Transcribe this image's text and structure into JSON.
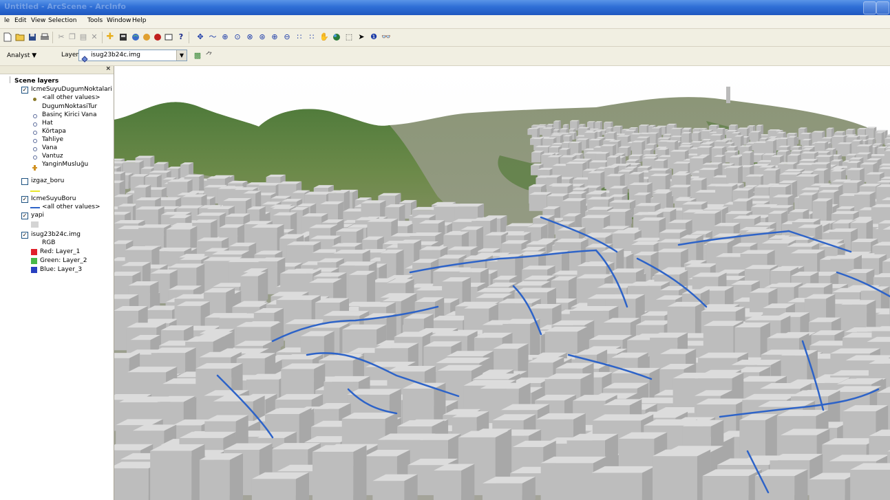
{
  "window": {
    "title": "Untitled - ArcScene - ArcInfo"
  },
  "menu": {
    "file": "le",
    "edit": "Edit",
    "view": "View",
    "selection": "Selection",
    "tools": "Tools",
    "window": "Window",
    "help": "Help"
  },
  "toolbar2": {
    "analyst_label": "Analyst ▼",
    "layer_label": "Layer:",
    "layer_value": "isug23b24c.img"
  },
  "toc": {
    "root": "Scene layers",
    "layers": [
      {
        "name": "IcmeSuyuDugumNoktalari",
        "checked": true
      },
      {
        "name": "izgaz_boru",
        "checked": false
      },
      {
        "name": "IcmeSuyuBoru",
        "checked": true
      },
      {
        "name": "yapi",
        "checked": true
      },
      {
        "name": "isug23b24c.img",
        "checked": true
      }
    ],
    "node_all_other": "<all other values>",
    "node_field": "DugumNoktasiTur",
    "node_values": [
      "Basinç Kirici Vana",
      "Hat",
      "Körtapa",
      "Tahliye",
      "Vana",
      "Vantuz",
      "YanginMusluğu"
    ],
    "pipe_all_other": "<all other values>",
    "raster_rgb": "RGB",
    "raster_red": "Red:   Layer_1",
    "raster_green": "Green: Layer_2",
    "raster_blue": "Blue:  Layer_3"
  },
  "colors": {
    "pipe": "#2d63c8",
    "gas_line": "#e8e62a",
    "building": "#c2c2c2",
    "red_band": "#e0202a",
    "green_band": "#48b848",
    "blue_band": "#2840c0",
    "node_marker": "#8a7a2a",
    "hydrant": "#d09020"
  }
}
